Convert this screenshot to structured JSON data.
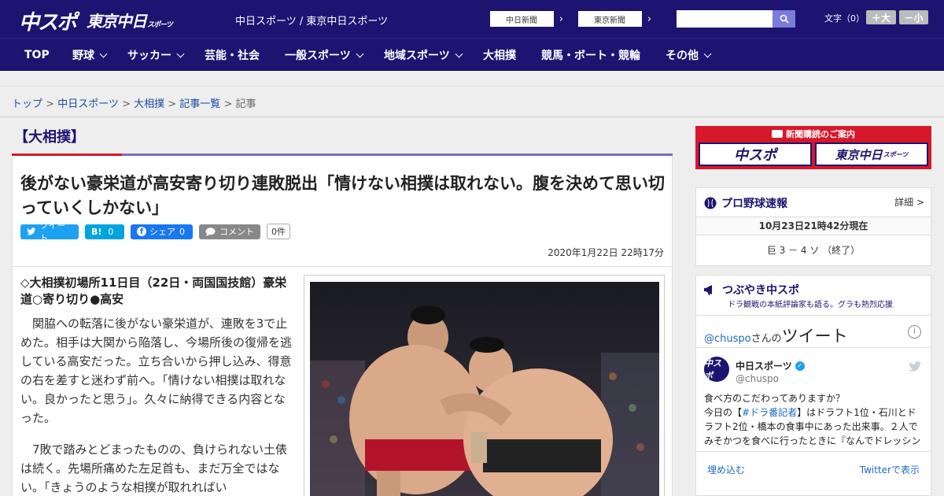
{
  "header": {
    "logo_chuspo": "中スポ",
    "logo_tokyo": "東京中日",
    "logo_tokyo_suffix": "スポーツ",
    "site_names": "中日スポーツ / 東京中日スポーツ",
    "chunichi_link": "中日新聞",
    "tokyo_link": "東京新聞",
    "search_placeholder": "",
    "font_size_label": "文字（0）",
    "font_plus": "＋大",
    "font_minus": "－小"
  },
  "nav": {
    "items": [
      {
        "label": "TOP"
      },
      {
        "label": "野球"
      },
      {
        "label": "サッカー"
      },
      {
        "label": "芸能・社会"
      },
      {
        "label": "一般スポーツ"
      },
      {
        "label": "地域スポーツ"
      },
      {
        "label": "大相撲"
      },
      {
        "label": "競馬・ボート・競輪"
      },
      {
        "label": "その他"
      }
    ]
  },
  "breadcrumb": {
    "top": "トップ",
    "chunichi": "中日スポーツ",
    "sumo": "大相撲",
    "list": "記事一覧",
    "current": "記事",
    "sep": " > "
  },
  "section": {
    "title": "【大相撲】"
  },
  "article": {
    "headline": "後がない豪栄道が高安寄り切り連敗脱出「情けない相撲は取れない。腹を決めて思い切っていくしかない」",
    "share": {
      "tweet": "ツイート",
      "hatena_label": "B!",
      "hatena_count": "0",
      "facebook": "シェア",
      "facebook_count": "0",
      "comment": "コメント",
      "comment_count": "0件"
    },
    "date": "2020年1月22日 22時17分",
    "lead": "◇大相撲初場所11日目（22日・両国国技館）豪栄道○寄り切り●高安",
    "para1": "関脇への転落に後がない豪栄道が、連敗を3で止めた。相手は大関から陥落し、今場所後の復帰を逃している高安だった。立ち合いから押し込み、得意の右を差すと迷わず前へ。「情けない相撲は取れない。良かったと思う」。久々に納得できる内容となった。",
    "para2": "7敗で踏みとどまったものの、負けられない土俵は続く。先場所痛めた左足首も、まだ万全ではない。「きょうのような相撲が取れればい"
  },
  "sidebar": {
    "ad_head": "新聞購読のご案内",
    "ad_logo_a": "中スポ",
    "ad_logo_b": "東京中日",
    "ad_logo_b_suffix": "スポーツ",
    "baseball": {
      "title": "プロ野球速報",
      "detail": "詳細 >",
      "time": "10月23日21時42分現在",
      "score": "巨 3 － 4 ソ （終了）"
    },
    "twitter": {
      "title": "つぶやき中スポ",
      "subtitle": "ドラ観戦の本紙評論家も語る。グラも熱烈応援",
      "handle": "@chuspo",
      "handle_suffix": "さんの",
      "tweets_label": "ツイート",
      "info": "i",
      "avatar_text": "中スポ",
      "account_name": "中日スポーツ",
      "account_id": "@chuspo",
      "tweet_line1": "食べ方のこだわってありますか？",
      "tweet_line2_pre": "今日の【",
      "tweet_line2_hashtag": "#ドラ番記者",
      "tweet_line2_post": "】はドラフト1位・石川とドラフト2位・橋本の食事中にあった出来事。２人でみそかつを食べに行ったときに『なんでドレッシング",
      "embed": "埋め込む",
      "view": "Twitterで表示"
    }
  }
}
